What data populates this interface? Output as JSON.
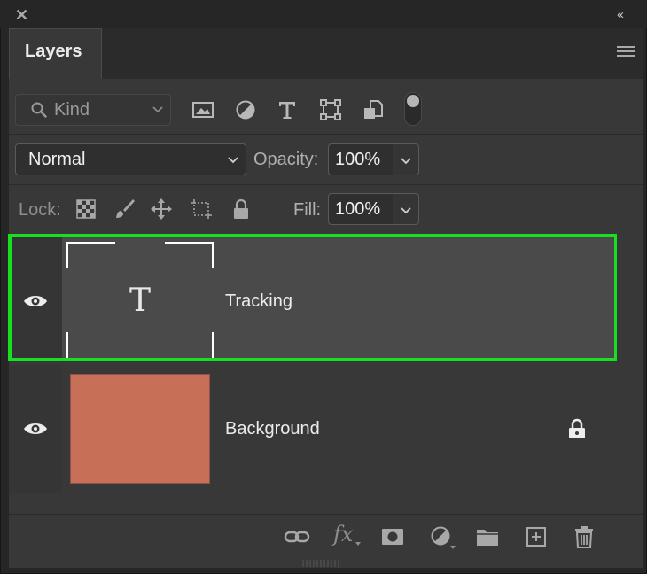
{
  "panel": {
    "tab_title": "Layers",
    "close_icon": "close-icon",
    "collapse_icon": "collapse-double-chevron-icon",
    "menu_icon": "panel-menu-icon"
  },
  "filter": {
    "kind_label": "Kind",
    "icons": [
      "image-filter-icon",
      "adjustment-filter-icon",
      "type-filter-icon",
      "shape-filter-icon",
      "smart-object-filter-icon"
    ]
  },
  "blend": {
    "mode": "Normal",
    "opacity_label": "Opacity:",
    "opacity_value": "100%"
  },
  "lock": {
    "label": "Lock:",
    "icons": [
      "lock-transparent-pixels-icon",
      "lock-image-pixels-icon",
      "lock-position-icon",
      "lock-artboard-icon",
      "lock-all-icon"
    ],
    "fill_label": "Fill:",
    "fill_value": "100%"
  },
  "layers": [
    {
      "name": "Tracking",
      "type": "text",
      "visible": true,
      "selected": true,
      "thumb_glyph": "T"
    },
    {
      "name": "Background",
      "type": "pixel",
      "visible": true,
      "locked": true,
      "thumb_color": "#c86f58"
    }
  ],
  "footer_icons": [
    "link-layers-icon",
    "layer-style-fx-icon",
    "add-mask-icon",
    "new-adjustment-layer-icon",
    "new-group-folder-icon",
    "new-layer-icon",
    "delete-layer-trash-icon"
  ],
  "footer_fx_label": "fx",
  "colors": {
    "panel_bg": "#383838",
    "selection_outline": "#17e021",
    "background_swatch": "#c86f58"
  }
}
